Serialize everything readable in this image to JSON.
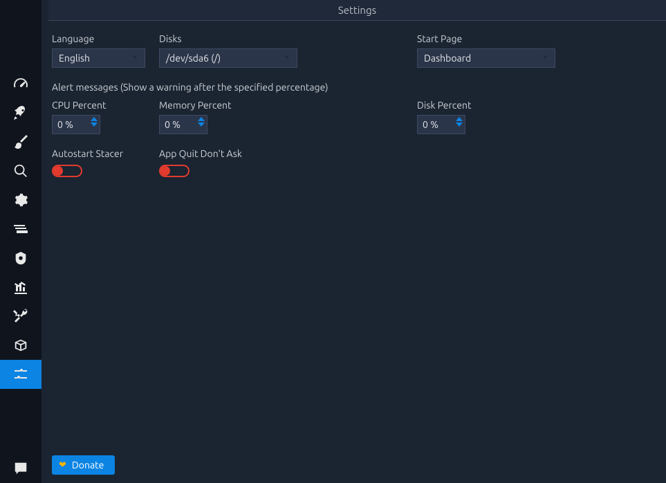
{
  "header": {
    "title": "Settings"
  },
  "labels": {
    "language": "Language",
    "disks": "Disks",
    "start_page": "Start Page",
    "alert": "Alert messages (Show a warning after the specified percentage)",
    "cpu_percent": "CPU Percent",
    "memory_percent": "Memory Percent",
    "disk_percent": "Disk Percent",
    "autostart": "Autostart Stacer",
    "app_quit": "App Quit Don't Ask"
  },
  "values": {
    "language": "English",
    "disks": "/dev/sda6  (/)",
    "start_page": "Dashboard",
    "cpu_percent": "0 %",
    "memory_percent": "0 %",
    "disk_percent": "0 %"
  },
  "donate": {
    "label": "Donate"
  }
}
